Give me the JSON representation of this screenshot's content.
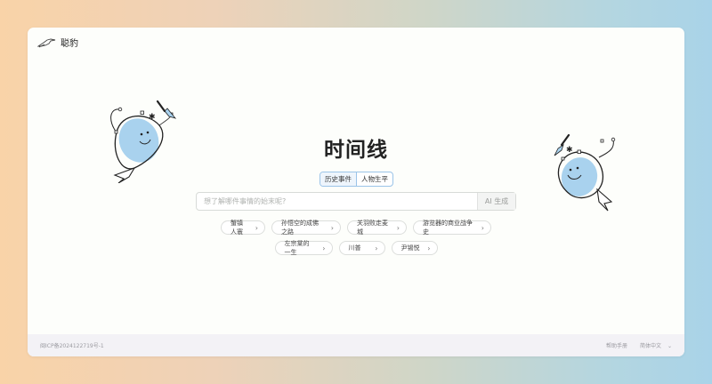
{
  "brand": {
    "name": "聪豹",
    "logo_icon": "bird-logo-icon"
  },
  "page": {
    "title": "时间线"
  },
  "tabs": [
    {
      "label": "历史事件",
      "active": true
    },
    {
      "label": "人物生平",
      "active": false
    }
  ],
  "search": {
    "placeholder": "想了解哪件事情的始末呢?",
    "value": "",
    "button_label": "AI 生成"
  },
  "suggestions": {
    "row1": [
      {
        "label": "蟹镇人寰"
      },
      {
        "label": "孙悟空的成佛之路"
      },
      {
        "label": "关羽败走麦城"
      },
      {
        "label": "游览器的商业战争史"
      }
    ],
    "row2": [
      {
        "label": "左宗棠的一生"
      },
      {
        "label": "川普"
      },
      {
        "label": "尹锡悦"
      }
    ]
  },
  "footer": {
    "icp": "闽ICP备2024122719号-1",
    "help": "帮助手册",
    "language": "简体中文"
  },
  "colors": {
    "accent": "#9bc4e8",
    "mascot_fill": "#a9d2ee"
  }
}
